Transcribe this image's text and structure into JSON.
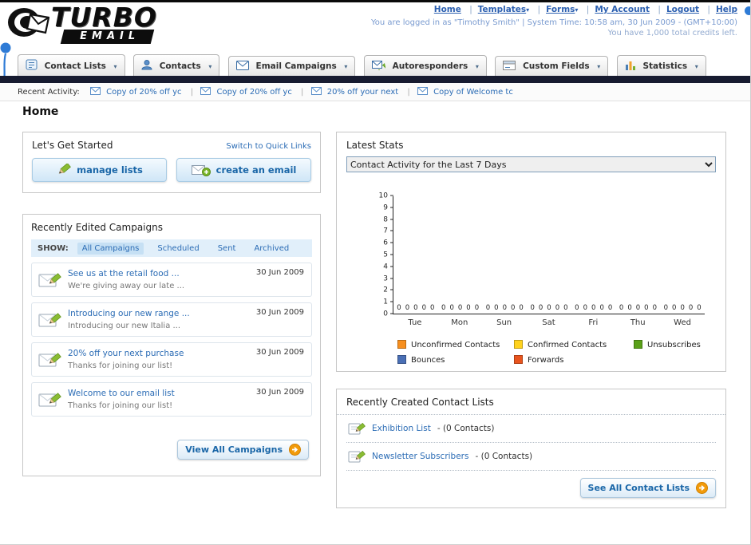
{
  "header": {
    "logo": {
      "word1": "TURBO",
      "word2": "EMAIL"
    },
    "links": [
      {
        "label": "Home"
      },
      {
        "label": "Templates"
      },
      {
        "label": "Forms"
      },
      {
        "label": "My Account"
      },
      {
        "label": "Logout"
      },
      {
        "label": "Help"
      }
    ],
    "session_line": "You are logged in as \"Timothy Smith\" | System Time: 10:58 am, 30 Jun 2009 - (GMT+10:00)",
    "credits_line": "You have 1,000 total credits left."
  },
  "nav_tabs": [
    {
      "label": "Contact Lists"
    },
    {
      "label": "Contacts"
    },
    {
      "label": "Email Campaigns"
    },
    {
      "label": "Autoresponders"
    },
    {
      "label": "Custom Fields"
    },
    {
      "label": "Statistics"
    }
  ],
  "recent_activity": {
    "label": "Recent Activity:",
    "items": [
      "Copy of 20% off yc",
      "Copy of 20% off yc",
      "20% off your next",
      "Copy of Welcome tc"
    ]
  },
  "page_title": "Home",
  "get_started": {
    "title": "Let's Get Started",
    "switch_link": "Switch to Quick Links",
    "manage_lists_label": "manage lists",
    "create_email_label": "create an email"
  },
  "campaigns": {
    "title": "Recently Edited Campaigns",
    "show_label": "SHOW:",
    "filters": [
      "All Campaigns",
      "Scheduled",
      "Sent",
      "Archived"
    ],
    "items": [
      {
        "title": "See us at the retail food ...",
        "subtitle": "We're giving away our late ...",
        "date": "30 Jun 2009"
      },
      {
        "title": "Introducing our new range ...",
        "subtitle": "Introducing our new Italia ...",
        "date": "30 Jun 2009"
      },
      {
        "title": "20% off your next purchase",
        "subtitle": "Thanks for joining our list!",
        "date": "30 Jun 2009"
      },
      {
        "title": "Welcome to our email list",
        "subtitle": "Thanks for joining our list!",
        "date": "30 Jun 2009"
      }
    ],
    "view_all_label": "View All Campaigns"
  },
  "stats": {
    "title": "Latest Stats",
    "range_option": "Contact Activity for the Last 7 Days",
    "chart_data": {
      "type": "bar",
      "title": "Contact Activity for the Last 7 Days",
      "categories": [
        "Tue",
        "Mon",
        "Sun",
        "Sat",
        "Fri",
        "Thu",
        "Wed"
      ],
      "series": [
        {
          "name": "Unconfirmed Contacts",
          "color": "#f78f1e",
          "values": [
            0,
            0,
            0,
            0,
            0,
            0,
            0
          ]
        },
        {
          "name": "Confirmed Contacts",
          "color": "#ffd21e",
          "values": [
            0,
            0,
            0,
            0,
            0,
            0,
            0
          ]
        },
        {
          "name": "Unsubscribes",
          "color": "#5aa018",
          "values": [
            0,
            0,
            0,
            0,
            0,
            0,
            0
          ]
        },
        {
          "name": "Bounces",
          "color": "#4a6fb5",
          "values": [
            0,
            0,
            0,
            0,
            0,
            0,
            0
          ]
        },
        {
          "name": "Forwards",
          "color": "#e8541e",
          "values": [
            0,
            0,
            0,
            0,
            0,
            0,
            0
          ]
        }
      ],
      "ylim": [
        0,
        10
      ],
      "xlabel": "",
      "ylabel": "",
      "grid": false,
      "legend_position": "bottom",
      "value_labels": true
    }
  },
  "contact_lists": {
    "title": "Recently Created Contact Lists",
    "items": [
      {
        "name": "Exhibition List",
        "detail": "- (0 Contacts)"
      },
      {
        "name": "Newsletter Subscribers",
        "detail": "- (0 Contacts)"
      }
    ],
    "see_all_label": "See All Contact Lists"
  },
  "colors": {
    "accent_blue": "#2b6cb5",
    "navbar_dark": "#171b30",
    "button_orange": "#f29b0b"
  }
}
